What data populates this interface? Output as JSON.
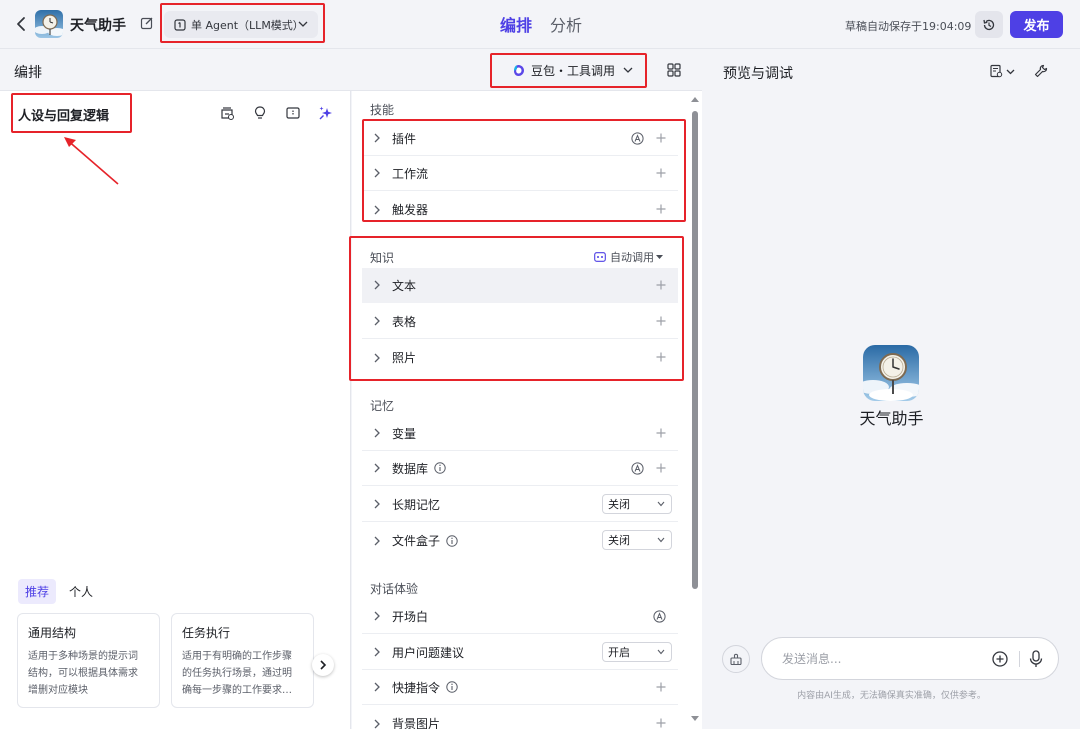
{
  "topbar": {
    "bot_name": "天气助手",
    "mode_label": "单 Agent（LLM模式）",
    "tabs": [
      {
        "label": "编排",
        "active": true
      },
      {
        "label": "分析",
        "active": false
      }
    ],
    "save_status": "草稿自动保存于19:04:09",
    "publish_label": "发布"
  },
  "arrangement": {
    "title": "编排",
    "model_label": "豆包・工具调用"
  },
  "prompt": {
    "title": "人设与回复逻辑",
    "template_tabs": [
      "推荐",
      "个人"
    ],
    "templates": [
      {
        "title": "通用结构",
        "lines": [
          "适用于多种场景的提示词",
          "结构，可以根据具体需求",
          "增删对应模块"
        ]
      },
      {
        "title": "任务执行",
        "lines": [
          "适用于有明确的工作步骤",
          "的任务执行场景，通过明",
          "确每一步骤的工作要求…"
        ]
      }
    ]
  },
  "skills": {
    "section_skill": "技能",
    "plugin": "插件",
    "workflow": "工作流",
    "trigger": "触发器",
    "section_knowledge": "知识",
    "auto_call": "自动调用",
    "text": "文本",
    "table": "表格",
    "photo": "照片",
    "section_memory": "记忆",
    "variable": "变量",
    "database": "数据库",
    "long_memory": "长期记忆",
    "long_memory_value": "关闭",
    "file_box": "文件盒子",
    "file_box_value": "关闭",
    "section_dialog": "对话体验",
    "opening": "开场白",
    "suggestion": "用户问题建议",
    "suggestion_value": "开启",
    "shortcut": "快捷指令",
    "background": "背景图片"
  },
  "preview": {
    "title": "预览与调试",
    "bot_name": "天气助手",
    "input_placeholder": "发送消息...",
    "disclaimer": "内容由AI生成，无法确保真实准确，仅供参考。"
  },
  "colors": {
    "accent": "#4e40e5",
    "highlight_box": "#e6232a"
  }
}
